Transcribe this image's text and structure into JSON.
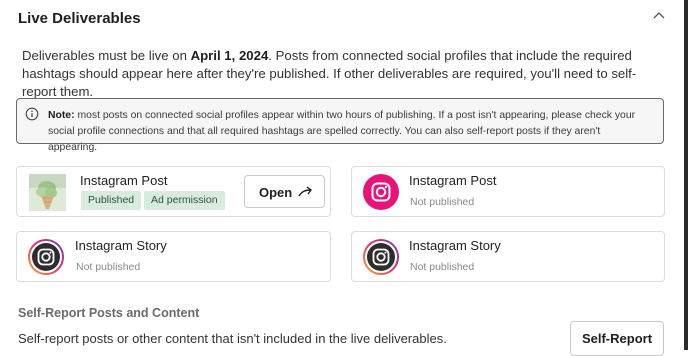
{
  "section": {
    "title": "Live Deliverables",
    "description_prefix": "Deliverables must be live on ",
    "description_date": "April 1, 2024",
    "description_suffix": ". Posts from connected social profiles that include the required hashtags should appear here after they're published. If other deliverables are required, you'll need to self-report them."
  },
  "note": {
    "label": "Note:",
    "text": " most posts on connected social profiles appear within two hours of publishing. If a post isn't appearing, please check your social profile connections and that all required hashtags are spelled correctly. You can also self-report posts if they aren't appearing."
  },
  "deliverables": [
    {
      "title": "Instagram Post",
      "badges": [
        "Published",
        "Ad permission"
      ],
      "action": "Open",
      "icon": "post-thumbnail-image"
    },
    {
      "title": "Instagram Post",
      "status": "Not published",
      "icon": "instagram-icon"
    },
    {
      "title": "Instagram Story",
      "status": "Not published",
      "icon": "instagram-story-icon"
    },
    {
      "title": "Instagram Story",
      "status": "Not published",
      "icon": "instagram-story-icon"
    }
  ],
  "self_report": {
    "title": "Self-Report Posts and Content",
    "description": "Self-report posts or other content that isn't included in the live deliverables.",
    "button": "Self-Report"
  },
  "colors": {
    "instagram_pink": "#e8137a",
    "published_badge_bg": "#d7ecde",
    "note_bg": "#f6f6f6"
  }
}
